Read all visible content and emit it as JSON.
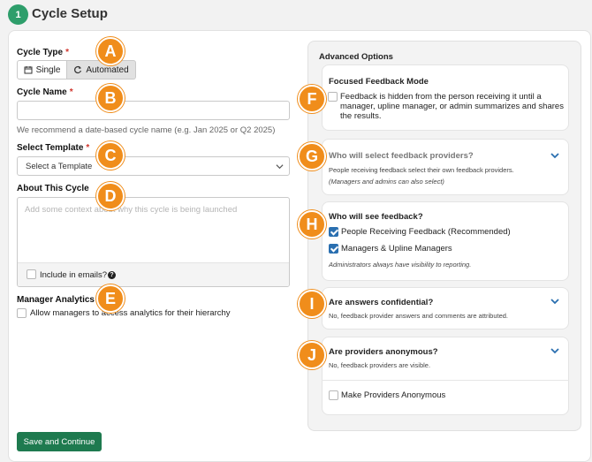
{
  "header": {
    "step": "1",
    "title": "Cycle Setup"
  },
  "form": {
    "cycle_type_label": "Cycle Type",
    "required_mark": "*",
    "single_label": "Single",
    "automated_label": "Automated",
    "cycle_name_label": "Cycle Name",
    "cycle_name_value": "",
    "cycle_name_help": "We recommend a date-based cycle name (e.g. Jan 2025 or Q2 2025)",
    "template_label": "Select Template",
    "template_value": "Select a Template",
    "about_label": "About This Cycle",
    "about_placeholder": "Add some context about why this cycle is being launched",
    "include_emails_label": "Include in emails?",
    "manager_analytics_label": "Manager Analytics",
    "manager_analytics_option": "Allow managers to access analytics for their hierarchy",
    "save_label": "Save and Continue"
  },
  "advanced": {
    "title": "Advanced Options",
    "focused": {
      "title": "Focused Feedback Mode",
      "text_line1": "Feedback is hidden from the person receiving it until a",
      "text_line2": "manager, upline manager, or admin summarizes and shares",
      "text_line3": "the results."
    },
    "providers": {
      "title": "Who will select feedback providers?",
      "sub": "People receiving feedback select their own feedback providers.",
      "note": "(Managers and admins can also select)"
    },
    "visibility": {
      "title": "Who will see feedback?",
      "opt1": "People Receiving Feedback (Recommended)",
      "opt2": "Managers & Upline Managers",
      "note": "Administrators always have visibility to reporting."
    },
    "confidential": {
      "title": "Are answers confidential?",
      "sub": "No, feedback provider answers and comments are attributed."
    },
    "anonymous": {
      "title": "Are providers anonymous?",
      "sub": "No, feedback providers are visible.",
      "option": "Make Providers Anonymous"
    }
  },
  "markers": [
    "A",
    "B",
    "C",
    "D",
    "E",
    "F",
    "G",
    "H",
    "I",
    "J"
  ],
  "colors": {
    "accent_green": "#2e9e6b",
    "save_green": "#1e7a4f",
    "marker_orange": "#f08d1b",
    "link_blue": "#2a6fb0"
  }
}
